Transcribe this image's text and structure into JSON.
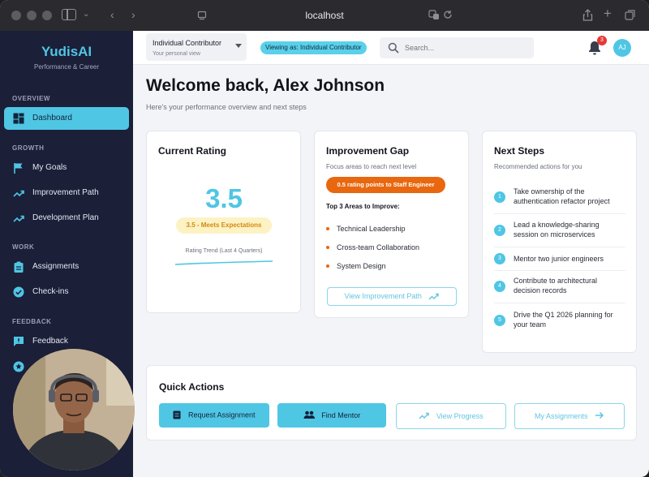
{
  "browser": {
    "url": "localhost"
  },
  "brand": {
    "name": "YudisAI",
    "tagline": "Performance & Career"
  },
  "sidebar": {
    "sections": {
      "overview": "OVERVIEW",
      "growth": "GROWTH",
      "work": "WORK",
      "feedback": "FEEDBACK"
    },
    "items": [
      {
        "label": "Dashboard",
        "icon": "dashboard-icon",
        "active": true
      },
      {
        "label": "My Goals",
        "icon": "flag-icon"
      },
      {
        "label": "Improvement Path",
        "icon": "trending-up-icon"
      },
      {
        "label": "Development Plan",
        "icon": "trending-up-icon"
      },
      {
        "label": "Assignments",
        "icon": "clipboard-icon"
      },
      {
        "label": "Check-ins",
        "icon": "check-circle-icon"
      },
      {
        "label": "Feedback",
        "icon": "feedback-icon"
      },
      {
        "label": "",
        "icon": "star-icon"
      }
    ]
  },
  "header": {
    "role_select": {
      "value": "Individual Contributor",
      "sub": "Your personal view"
    },
    "viewing_badge": "Viewing as: Individual Contributor",
    "search": {
      "placeholder": "Search..."
    },
    "notifications": {
      "count": "3"
    },
    "avatar_initials": "AJ"
  },
  "main": {
    "title": "Welcome back, Alex Johnson",
    "subtitle": "Here's your performance overview and next steps"
  },
  "current_rating": {
    "title": "Current Rating",
    "value": "3.5",
    "badge": "3.5 - Meets Expectations",
    "trend_label": "Rating Trend (Last 4 Quarters)"
  },
  "improvement_gap": {
    "title": "Improvement Gap",
    "subtitle": "Focus areas to reach next level",
    "badge": "0.5 rating points to Staff Engineer",
    "areas_heading": "Top 3 Areas to Improve:",
    "areas": [
      "Technical Leadership",
      "Cross-team Collaboration",
      "System Design"
    ],
    "button": "View Improvement Path"
  },
  "next_steps": {
    "title": "Next Steps",
    "subtitle": "Recommended actions for you",
    "steps": [
      {
        "num": "1",
        "text": "Take ownership of the authentication refactor project"
      },
      {
        "num": "2",
        "text": "Lead a knowledge-sharing session on microservices"
      },
      {
        "num": "3",
        "text": "Mentor two junior engineers"
      },
      {
        "num": "4",
        "text": "Contribute to architectural decision records"
      },
      {
        "num": "5",
        "text": "Drive the Q1 2026 planning for your team"
      }
    ]
  },
  "quick_actions": {
    "title": "Quick Actions",
    "buttons": [
      "Request Assignment",
      "Find Mentor",
      "View Progress",
      "My Assignments"
    ]
  },
  "colors": {
    "accent": "#4fc6e4",
    "sidebar_bg": "#1b1f38",
    "warning": "#e8670f",
    "rating_badge_bg": "#fdf2c4"
  }
}
